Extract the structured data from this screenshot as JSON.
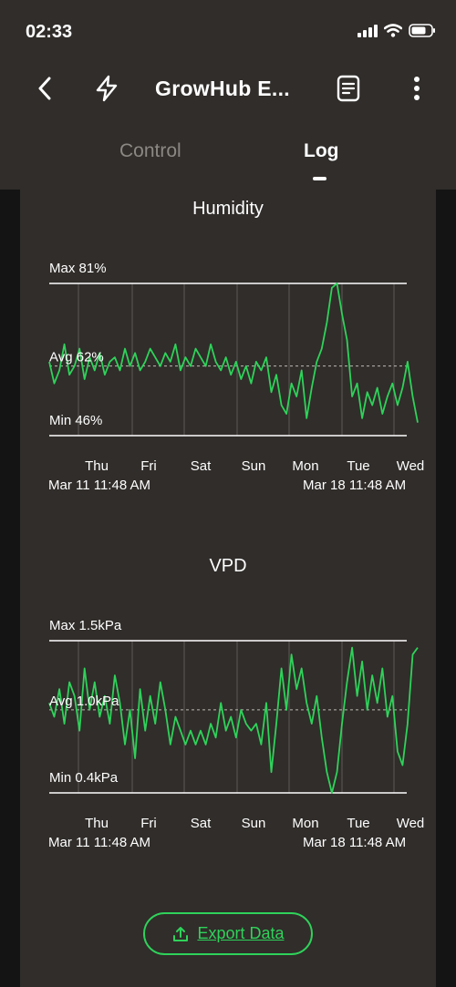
{
  "status_bar": {
    "time": "02:33"
  },
  "header": {
    "title": "GrowHub E..."
  },
  "tabs": [
    {
      "label": "Control",
      "active": false
    },
    {
      "label": "Log",
      "active": true
    }
  ],
  "colors": {
    "accent": "#2fd25a",
    "panel": "#302d2a",
    "background": "#141414"
  },
  "charts": [
    {
      "title": "Humidity",
      "max_label": "Max 81%",
      "avg_label": "Avg 62%",
      "min_label": "Min 46%",
      "start_date": "Mar 11 11:48 AM",
      "end_date": "Mar 18 11:48 AM",
      "days": [
        "Thu",
        "Fri",
        "Sat",
        "Sun",
        "Mon",
        "Tue",
        "Wed"
      ]
    },
    {
      "title": "VPD",
      "max_label": "Max 1.5kPa",
      "avg_label": "Avg 1.0kPa",
      "min_label": "Min 0.4kPa",
      "start_date": "Mar 11 11:48 AM",
      "end_date": "Mar 18 11:48 AM",
      "days": [
        "Thu",
        "Fri",
        "Sat",
        "Sun",
        "Mon",
        "Tue",
        "Wed"
      ]
    }
  ],
  "chart_data": [
    {
      "type": "line",
      "title": "Humidity",
      "ylabel": "%",
      "ylim": [
        46,
        81
      ],
      "avg": 62,
      "x": [
        "Thu",
        "Fri",
        "Sat",
        "Sun",
        "Mon",
        "Tue",
        "Wed"
      ],
      "series": [
        {
          "values": [
            63,
            58,
            61,
            67,
            60,
            62,
            66,
            59,
            64,
            61,
            65,
            60,
            63,
            64,
            61,
            66,
            62,
            65,
            61,
            63,
            66,
            64,
            62,
            65,
            63,
            67,
            61,
            64,
            62,
            66,
            64,
            62,
            67,
            63,
            61,
            64,
            60,
            63,
            59,
            62,
            58,
            63,
            61,
            64,
            56,
            60,
            53,
            51,
            58,
            55,
            61,
            50,
            57,
            63,
            66,
            72,
            80,
            81,
            74,
            68,
            55,
            58,
            50,
            56,
            53,
            57,
            51,
            55,
            58,
            53,
            57,
            63,
            55,
            49
          ]
        }
      ]
    },
    {
      "type": "line",
      "title": "VPD",
      "ylabel": "kPa",
      "ylim": [
        0.4,
        1.5
      ],
      "avg": 1.0,
      "x": [
        "Thu",
        "Fri",
        "Sat",
        "Sun",
        "Mon",
        "Tue",
        "Wed"
      ],
      "series": [
        {
          "values": [
            1.05,
            0.95,
            1.15,
            0.9,
            1.2,
            1.1,
            0.85,
            1.3,
            1.0,
            1.2,
            0.95,
            1.1,
            0.9,
            1.25,
            1.05,
            0.75,
            1.0,
            0.65,
            1.15,
            0.85,
            1.1,
            0.9,
            1.2,
            1.0,
            0.75,
            0.95,
            0.85,
            0.75,
            0.85,
            0.75,
            0.85,
            0.75,
            0.9,
            0.8,
            1.05,
            0.85,
            0.95,
            0.8,
            1.0,
            0.9,
            0.85,
            0.9,
            0.75,
            1.05,
            0.55,
            0.9,
            1.3,
            1.0,
            1.4,
            1.15,
            1.3,
            1.05,
            0.9,
            1.1,
            0.8,
            0.55,
            0.4,
            0.55,
            0.9,
            1.2,
            1.45,
            1.1,
            1.35,
            1.0,
            1.25,
            1.05,
            1.3,
            0.95,
            1.1,
            0.7,
            0.6,
            0.9,
            1.4,
            1.45
          ]
        }
      ]
    }
  ]
}
